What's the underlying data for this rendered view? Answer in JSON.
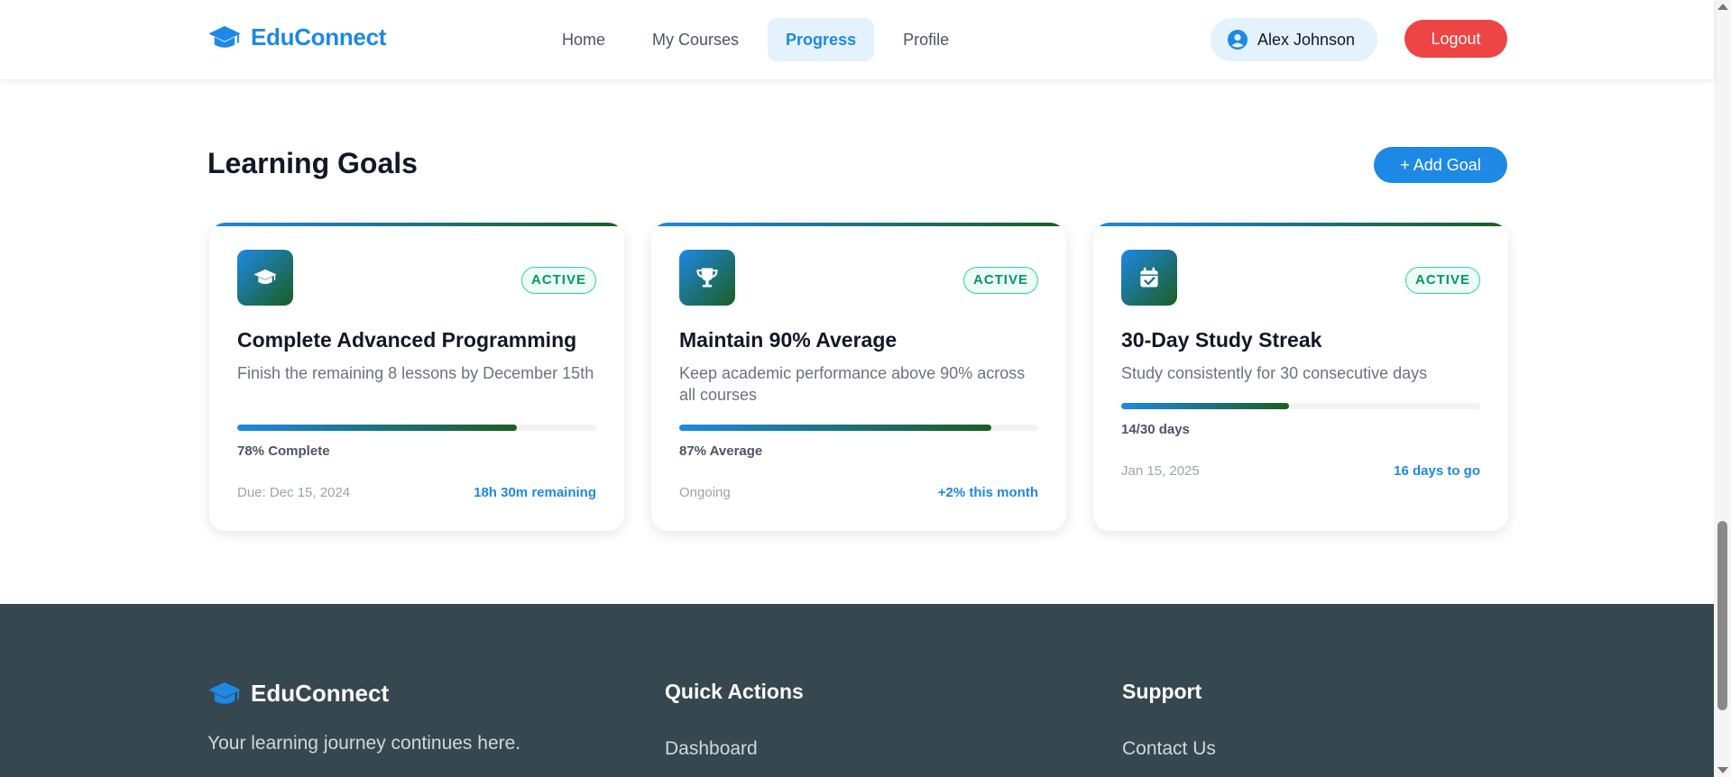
{
  "header": {
    "brand": "EduConnect",
    "brand_icon": "graduation-cap-icon",
    "nav": [
      {
        "label": "Home",
        "active": false
      },
      {
        "label": "My Courses",
        "active": false
      },
      {
        "label": "Progress",
        "active": true
      },
      {
        "label": "Profile",
        "active": false
      }
    ],
    "user_name": "Alex Johnson",
    "user_icon": "user-circle-icon",
    "logout_label": "Logout"
  },
  "goals_section": {
    "title": "Learning Goals",
    "add_label": "+ Add Goal",
    "goals": [
      {
        "icon": "graduation-cap-icon",
        "status": "ACTIVE",
        "title": "Complete Advanced Programming",
        "description": "Finish the remaining 8 lessons by December 15th",
        "progress_percent": 78,
        "progress_label": "78% Complete",
        "date": "Due: Dec 15, 2024",
        "extra": "18h 30m remaining"
      },
      {
        "icon": "trophy-icon",
        "status": "ACTIVE",
        "title": "Maintain 90% Average",
        "description": "Keep academic performance above 90% across all courses",
        "progress_percent": 87,
        "progress_label": "87% Average",
        "date": "Ongoing",
        "extra": "+2% this month"
      },
      {
        "icon": "calendar-check-icon",
        "status": "ACTIVE",
        "title": "30-Day Study Streak",
        "description": "Study consistently for 30 consecutive days",
        "progress_percent": 46.7,
        "progress_label": "14/30 days",
        "date": "Jan 15, 2025",
        "extra": "16 days to go"
      }
    ]
  },
  "footer": {
    "brand": "EduConnect",
    "tagline": "Your learning journey continues here.",
    "columns": [
      {
        "heading": "Quick Actions",
        "link": "Dashboard"
      },
      {
        "heading": "Support",
        "link": "Contact Us"
      }
    ]
  },
  "colors": {
    "primary": "#1e88e5",
    "gradient_end": "#1b5e20",
    "danger": "#ef4444",
    "success": "#059669",
    "footer_bg": "#37474f"
  }
}
